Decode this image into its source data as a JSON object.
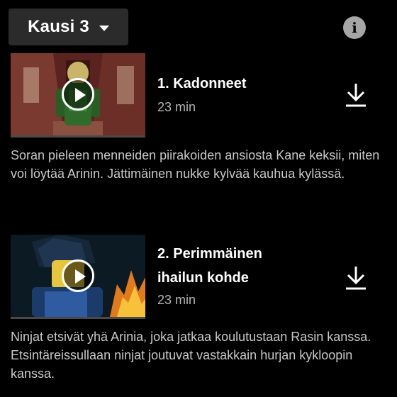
{
  "season": {
    "label": "Kausi 3"
  },
  "info": {
    "icon": "info-icon"
  },
  "episodes": [
    {
      "title": "1. Kadonneet",
      "duration": "23 min",
      "synopsis": "Soran pieleen menneiden piirakoiden ansiosta Kane keksii, miten voi löytää Arinin. Jättimäinen nukke kylvää kauhua kylässä."
    },
    {
      "title": "2. Perimmäinen ihailun kohde",
      "duration": "23 min",
      "synopsis": "Ninjat etsivät yhä Arinia, joka jatkaa koulutustaan Rasin kanssa. Etsintäreissullaan ninjat joutuvat vastakkain hurjan kykloopin kanssa."
    }
  ]
}
